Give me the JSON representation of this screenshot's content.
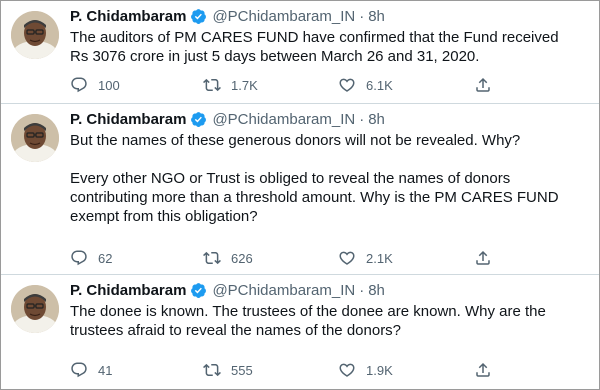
{
  "tweets": [
    {
      "author": {
        "name": "P. Chidambaram",
        "handle": "@PChidambaram_IN",
        "verified": true
      },
      "time": "8h",
      "separator": "·",
      "text": [
        "The auditors of PM CARES FUND have confirmed that the Fund received Rs 3076 crore in just 5 days between March 26 and 31, 2020."
      ],
      "counts": {
        "replies": "100",
        "retweets": "1.7K",
        "likes": "6.1K"
      }
    },
    {
      "author": {
        "name": "P. Chidambaram",
        "handle": "@PChidambaram_IN",
        "verified": true
      },
      "time": "8h",
      "separator": "·",
      "text": [
        "But the names of these generous donors will not be revealed. Why?",
        "Every other NGO or Trust is obliged to reveal the names of donors contributing more than a threshold amount. Why is the PM CARES FUND exempt from this obligation?"
      ],
      "counts": {
        "replies": "62",
        "retweets": "626",
        "likes": "2.1K"
      }
    },
    {
      "author": {
        "name": "P. Chidambaram",
        "handle": "@PChidambaram_IN",
        "verified": true
      },
      "time": "8h",
      "separator": "·",
      "text": [
        "The donee is known. The trustees of the donee are known. Why are the trustees afraid to reveal the names of the donors?"
      ],
      "counts": {
        "replies": "41",
        "retweets": "555",
        "likes": "1.9K"
      }
    }
  ],
  "icons": {
    "reply": "reply-icon",
    "retweet": "retweet-icon",
    "like": "heart-icon",
    "share": "share-icon",
    "verified": "verified-badge-icon"
  },
  "colors": {
    "verified": "#1d9bf0",
    "text": "#0f1419",
    "secondary": "#536471",
    "divider": "#cfd9de"
  }
}
